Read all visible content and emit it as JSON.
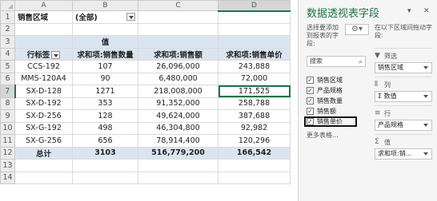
{
  "sheet": {
    "col_headers": [
      "A",
      "B",
      "C",
      "D"
    ],
    "row_numbers": [
      "1",
      "2",
      "3",
      "4",
      "5",
      "6",
      "7",
      "8",
      "9",
      "10",
      "11",
      "12",
      "13",
      "14"
    ],
    "filter_label": "销售区域",
    "filter_value": "(全部)",
    "values_title": "值",
    "col_row_label": "行标签",
    "col_qty": "求和项:销售数量",
    "col_amount": "求和项:销售额",
    "col_price": "求和项:销售单价",
    "rows": [
      {
        "label": "CCS-192",
        "qty": "107",
        "amount": "26,096,000",
        "price": "243,888"
      },
      {
        "label": "MMS-120A4",
        "qty": "90",
        "amount": "6,480,000",
        "price": "72,000"
      },
      {
        "label": "SX-D-128",
        "qty": "1271",
        "amount": "218,008,000",
        "price": "171,525"
      },
      {
        "label": "SX-D-192",
        "qty": "353",
        "amount": "91,352,000",
        "price": "258,788"
      },
      {
        "label": "SX-D-256",
        "qty": "128",
        "amount": "49,624,000",
        "price": "387,688"
      },
      {
        "label": "SX-G-192",
        "qty": "498",
        "amount": "46,304,800",
        "price": "92,982"
      },
      {
        "label": "SX-G-256",
        "qty": "656",
        "amount": "78,914,400",
        "price": "120,296"
      }
    ],
    "total_label": "总计",
    "total_qty": "3103",
    "total_amount": "516,779,200",
    "total_price": "166,542"
  },
  "pane": {
    "title": "数据透视表字段",
    "choose_text": "选择要添加到报表的字段:",
    "drag_text": "在以下区域间拖动字段:",
    "search_placeholder": "搜索",
    "fields": [
      {
        "label": "销售区域",
        "checked": "✓"
      },
      {
        "label": "产品规格",
        "checked": "✓"
      },
      {
        "label": "销售数量",
        "checked": "✓"
      },
      {
        "label": "销售额",
        "checked": "✓"
      },
      {
        "label": "销售单价",
        "checked": "✓"
      }
    ],
    "more_tables": "更多表格...",
    "filter_area": "筛选",
    "filter_value": "销售区域",
    "col_area": "列",
    "col_value": "Σ 数值",
    "row_area": "行",
    "row_value": "产品规格",
    "values_area": "值",
    "values_value": "求和项:销..."
  }
}
